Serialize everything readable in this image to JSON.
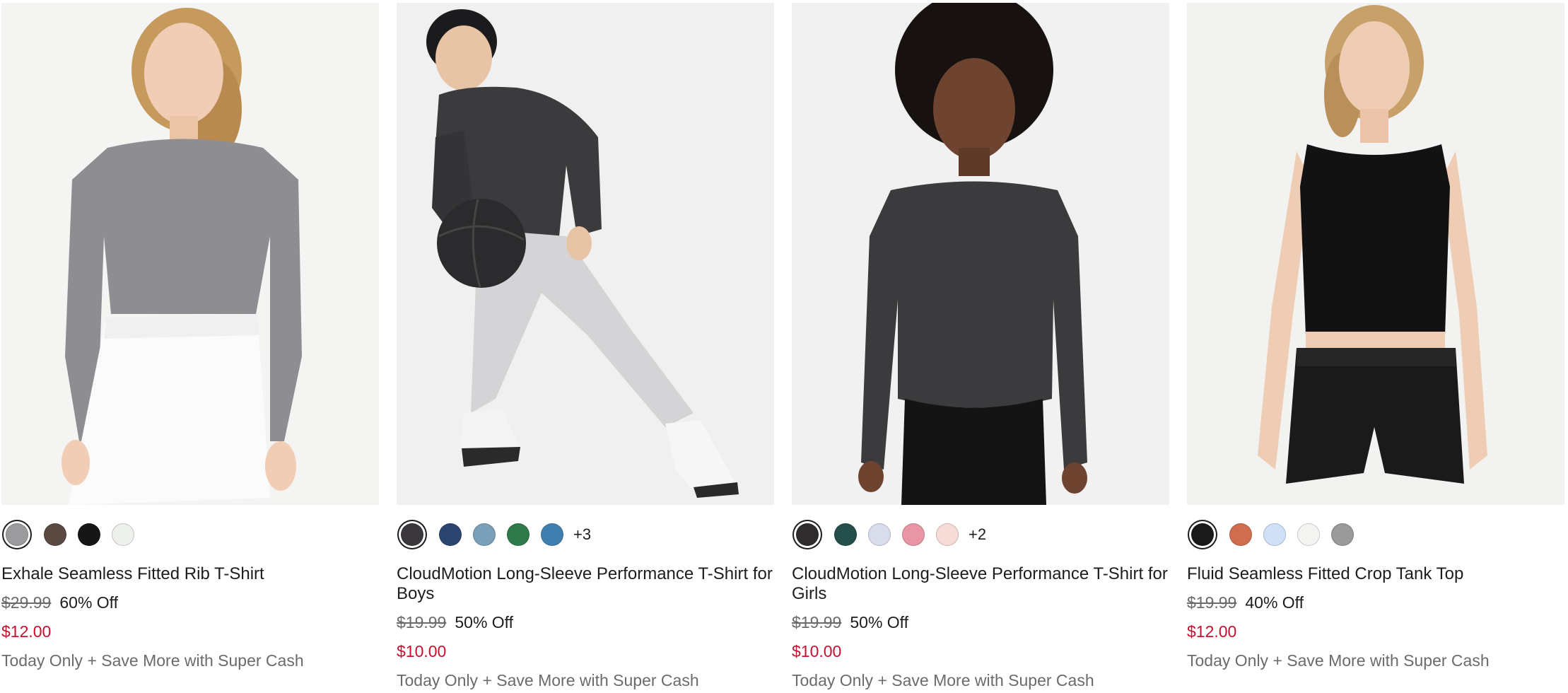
{
  "products": [
    {
      "name": "Exhale Seamless Fitted Rib T-Shirt",
      "original_price": "$29.99",
      "discount": "60% Off",
      "sale_price": "$12.00",
      "promo": "Today Only + Save More with Super Cash",
      "swatches": [
        "#9c9c9e",
        "#5a4a42",
        "#161616",
        "#eef0ec"
      ],
      "more_colors": "",
      "image_icon": "woman-gray-rib-tshirt-photo"
    },
    {
      "name": "CloudMotion Long-Sleeve Performance T-Shirt for Boys",
      "original_price": "$19.99",
      "discount": "50% Off",
      "sale_price": "$10.00",
      "promo": "Today Only + Save More with Super Cash",
      "swatches": [
        "#3a383c",
        "#2c4570",
        "#7a9fb8",
        "#2f7a4a",
        "#3f7fb0"
      ],
      "more_colors": "+3",
      "image_icon": "boy-with-basketball-photo"
    },
    {
      "name": "CloudMotion Long-Sleeve Performance T-Shirt for Girls",
      "original_price": "$19.99",
      "discount": "50% Off",
      "sale_price": "$10.00",
      "promo": "Today Only + Save More with Super Cash",
      "swatches": [
        "#2f2c2e",
        "#244f4b",
        "#d9dcea",
        "#e896a6",
        "#f7dcd8"
      ],
      "more_colors": "+2",
      "image_icon": "girl-dark-longsleeve-photo"
    },
    {
      "name": "Fluid Seamless Fitted Crop Tank Top",
      "original_price": "$19.99",
      "discount": "40% Off",
      "sale_price": "$12.00",
      "promo": "Today Only + Save More with Super Cash",
      "swatches": [
        "#1a1a1a",
        "#cf6d4e",
        "#cfe0f7",
        "#f4f4f2",
        "#9a9a9a"
      ],
      "more_colors": "",
      "image_icon": "woman-black-crop-tank-photo"
    }
  ],
  "colors": {
    "sale": "#c8102e",
    "muted": "#6b6b6b",
    "text": "#1d1d1d"
  }
}
